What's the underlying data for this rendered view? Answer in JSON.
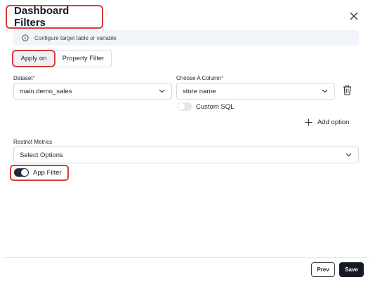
{
  "header": {
    "title": "Dashboard Filters"
  },
  "info": {
    "text": "Configure target table or variable"
  },
  "tabs": [
    {
      "label": "Apply on",
      "active": true
    },
    {
      "label": "Property Filter",
      "active": false
    }
  ],
  "dataset": {
    "label": "Dataset",
    "required_mark": "*",
    "value": "main.demo_sales"
  },
  "column": {
    "label": "Choose A Column",
    "required_mark": "*",
    "value": "store name"
  },
  "custom_sql": {
    "label": "Custom SQL",
    "enabled": false
  },
  "add_option": {
    "label": "Add option"
  },
  "restrict_metrics": {
    "label": "Restrict Metrics",
    "placeholder": "Select Options"
  },
  "app_filter": {
    "label": "App Filter",
    "enabled": true
  },
  "footer": {
    "prev_label": "Prev",
    "save_label": "Save"
  },
  "colors": {
    "accent_red": "#d93a3a",
    "dark": "#141a24",
    "info_bg": "#f2f4fc"
  }
}
